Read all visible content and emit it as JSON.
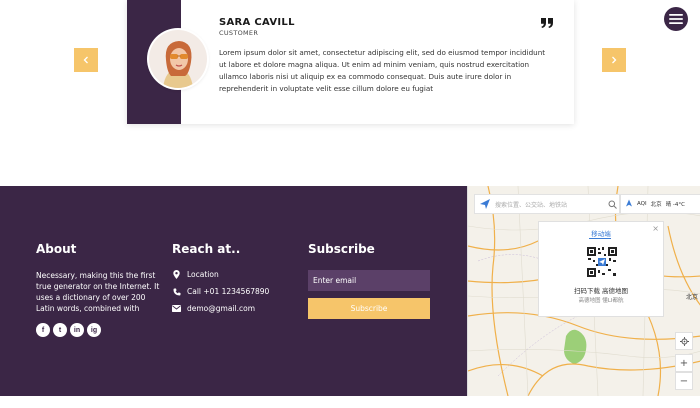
{
  "testimonial": {
    "name": "SARA CAVILL",
    "role": "CUSTOMER",
    "text": "Lorem ipsum dolor sit amet, consectetur adipiscing elit, sed do eiusmod tempor incididunt ut labore et dolore magna aliqua. Ut enim ad minim veniam, quis nostrud exercitation ullamco laboris nisi ut aliquip ex ea commodo consequat. Duis aute irure dolor in reprehenderit in voluptate velit esse cillum dolore eu fugiat",
    "prev_icon": "chevron-left-icon",
    "next_icon": "chevron-right-icon",
    "quote_icon": "quote-icon"
  },
  "nav": {
    "menu_icon": "hamburger-icon"
  },
  "footer": {
    "about": {
      "heading": "About",
      "text": "Necessary, making this the first true generator on the Internet. It uses a dictionary of over 200 Latin words, combined with",
      "socials": [
        "f",
        "t",
        "in",
        "ig"
      ]
    },
    "reach": {
      "heading": "Reach at..",
      "location": "Location",
      "phone": "Call +01 1234567890",
      "email": "demo@gmail.com"
    },
    "subscribe": {
      "heading": "Subscribe",
      "email_placeholder": "Enter email",
      "button_label": "Subscribe"
    }
  },
  "map": {
    "search_placeholder": "搜索位置、公交站、地铁站",
    "toolbar_city": "北京",
    "toolbar_weather": "晴 -4°C",
    "toolbar_aqi": "AQI",
    "popup_title": "移动端",
    "popup_line1": "扫码下载 高德地图",
    "popup_line2": "高德地图 懂LI都航",
    "city_label": "北京",
    "zoom_in": "+",
    "zoom_out": "−",
    "colors": {
      "park": "#9ccf78",
      "road": "#f0b04a",
      "popup_accent": "#3a7bd5"
    }
  },
  "colors": {
    "accent": "#3b2646",
    "button": "#f6c56a"
  }
}
